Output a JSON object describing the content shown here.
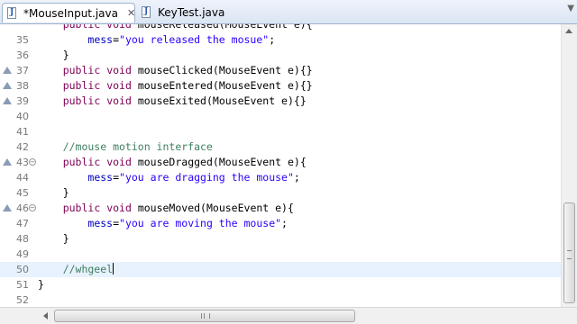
{
  "tabs": [
    {
      "label": "*MouseInput.java",
      "active": true
    },
    {
      "label": "KeyTest.java",
      "active": false
    }
  ],
  "tab_close_glyph": "✕",
  "editor": {
    "lines": [
      {
        "number": "35",
        "text": "        mess=\"you released the mosue\";"
      },
      {
        "number": "36",
        "text": "    }"
      },
      {
        "number": "37",
        "text": "    public void mouseClicked(MouseEvent e){}"
      },
      {
        "number": "38",
        "text": "    public void mouseEntered(MouseEvent e){}"
      },
      {
        "number": "39",
        "text": "    public void mouseExited(MouseEvent e){}"
      },
      {
        "number": "40",
        "text": ""
      },
      {
        "number": "41",
        "text": ""
      },
      {
        "number": "42",
        "text": "    //mouse motion interface"
      },
      {
        "number": "43",
        "text": "    public void mouseDragged(MouseEvent e){"
      },
      {
        "number": "44",
        "text": "        mess=\"you are dragging the mouse\";"
      },
      {
        "number": "45",
        "text": "    }"
      },
      {
        "number": "46",
        "text": "    public void mouseMoved(MouseEvent e){"
      },
      {
        "number": "47",
        "text": "        mess=\"you are moving the mouse\";"
      },
      {
        "number": "48",
        "text": "    }"
      },
      {
        "number": "49",
        "text": ""
      },
      {
        "number": "50",
        "text": "    //whgeel"
      },
      {
        "number": "51",
        "text": "}"
      },
      {
        "number": "52",
        "text": ""
      }
    ],
    "current_line": "50"
  },
  "colors": {
    "keyword": "#7f0055",
    "string": "#2a00ff",
    "field": "#0000c0",
    "comment": "#3f7f5f",
    "current_line_bg": "#e8f2fe"
  }
}
